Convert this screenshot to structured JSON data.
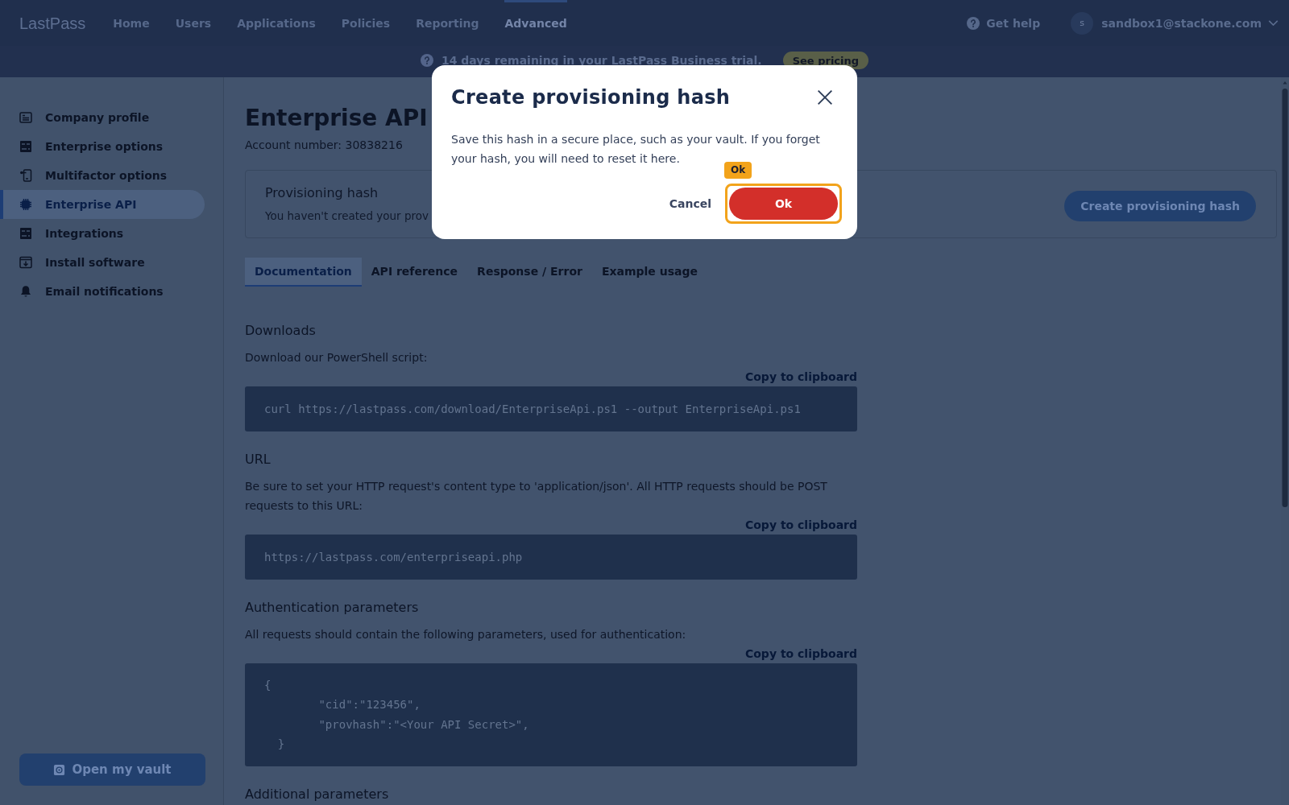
{
  "top_nav": {
    "logo": "LastPass",
    "items": [
      {
        "label": "Home",
        "selected": false
      },
      {
        "label": "Users",
        "selected": false
      },
      {
        "label": "Applications",
        "selected": false
      },
      {
        "label": "Policies",
        "selected": false
      },
      {
        "label": "Reporting",
        "selected": false
      },
      {
        "label": "Advanced",
        "selected": true
      }
    ],
    "help": "Get help",
    "avatar": "s",
    "user": "sandbox1@stackone.com"
  },
  "trial_banner": {
    "text": "14 days remaining in your LastPass Business trial.",
    "button": "See pricing"
  },
  "sidebar": {
    "items": [
      {
        "label": "Company profile",
        "selected": false
      },
      {
        "label": "Enterprise options",
        "selected": false
      },
      {
        "label": "Multifactor options",
        "selected": false
      },
      {
        "label": "Enterprise API",
        "selected": true
      },
      {
        "label": "Integrations",
        "selected": false
      },
      {
        "label": "Install software",
        "selected": false
      },
      {
        "label": "Email notifications",
        "selected": false
      }
    ],
    "vault_button": "Open my vault"
  },
  "page": {
    "title": "Enterprise API",
    "account": "Account number: 30838216",
    "hash_card": {
      "title": "Provisioning hash",
      "text": "You haven't created your prov",
      "button": "Create provisioning hash"
    },
    "tabs": [
      {
        "label": "Documentation",
        "selected": true
      },
      {
        "label": "API reference",
        "selected": false
      },
      {
        "label": "Response / Error",
        "selected": false
      },
      {
        "label": "Example usage",
        "selected": false
      }
    ],
    "sections": [
      {
        "heading": "Downloads",
        "description": "Download our PowerShell script:",
        "copy": "Copy to clipboard",
        "code": "curl https://lastpass.com/download/EnterpriseApi.ps1 --output EnterpriseApi.ps1"
      },
      {
        "heading": "URL",
        "description": "Be sure to set your HTTP request's content type to 'application/json'. All HTTP requests should be POST requests to this URL:",
        "copy": "Copy to clipboard",
        "code": "https://lastpass.com/enterpriseapi.php"
      },
      {
        "heading": "Authentication parameters",
        "description": "All requests should contain the following parameters, used for authentication:",
        "copy": "Copy to clipboard",
        "code": "{\n\t\"cid\":\"123456\",\n\t\"provhash\":\"<Your API Secret>\",\n  }"
      },
      {
        "heading": "Additional parameters"
      }
    ]
  },
  "dialog": {
    "title": "Create provisioning hash",
    "message": "Save this hash in a secure place, such as your vault. If you forget your hash, you will need to reset it here.",
    "cancel": "Cancel",
    "ok": {
      "label": "Ok",
      "focused": true
    },
    "focus_hint": "Ok"
  }
}
